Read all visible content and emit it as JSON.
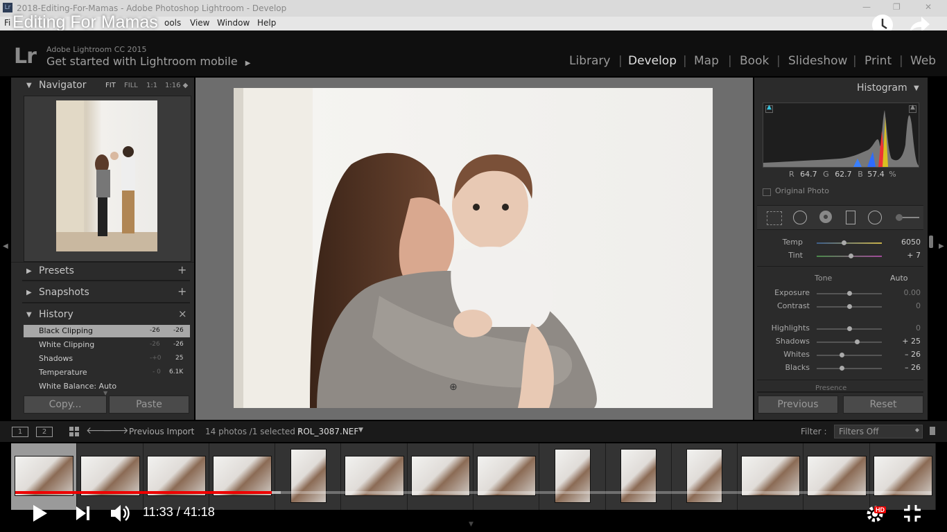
{
  "window": {
    "title": "2018-Editing-For-Mamas - Adobe Photoshop Lightroom - Develop",
    "app_icon": "Lr",
    "controls": [
      "—",
      "❐",
      "✕"
    ]
  },
  "menu": {
    "items": [
      "Fi",
      "ools",
      "View",
      "Window",
      "Help"
    ]
  },
  "video": {
    "title": "Editing For Mamas",
    "time": "11:33 / 41:18",
    "progress": 0.28,
    "quality_badge": "HD",
    "colors": {
      "played": "#e00000"
    }
  },
  "lr_header": {
    "logo": "Lr",
    "version": "Adobe Lightroom CC 2015",
    "mobile": "Get started with Lightroom mobile",
    "mobile_arrow": "▶",
    "modules": [
      "Library",
      "Develop",
      "Map",
      "Book",
      "Slideshow",
      "Print",
      "Web"
    ],
    "active_module": "Develop"
  },
  "left_panel": {
    "navigator": {
      "title": "Navigator",
      "zoom_options": [
        "FIT",
        "FILL",
        "1:1",
        "1:16 ◆"
      ]
    },
    "presets": {
      "title": "Presets",
      "action": "+"
    },
    "snapshots": {
      "title": "Snapshots",
      "action": "+"
    },
    "history": {
      "title": "History",
      "action": "×",
      "rows": [
        {
          "label": "Black Clipping",
          "a": "-26",
          "b": "-26",
          "selected": true
        },
        {
          "label": "White Clipping",
          "a": "-26",
          "b": "-26",
          "selected": false
        },
        {
          "label": "Shadows",
          "a": "-+0",
          "b": "25",
          "selected": false
        },
        {
          "label": "Temperature",
          "a": "- 0",
          "b": "6.1K",
          "selected": false
        },
        {
          "label": "White Balance: Auto",
          "a": "",
          "b": "",
          "selected": false
        }
      ]
    },
    "copy_label": "Copy...",
    "paste_label": "Paste"
  },
  "right_panel": {
    "histogram": {
      "title": "Histogram",
      "readout": {
        "r_label": "R",
        "r": "64.7",
        "g_label": "G",
        "g": "62.7",
        "b_label": "B",
        "b": "57.4",
        "unit": "%"
      },
      "original_photo_label": "Original Photo"
    },
    "wb": [
      {
        "label": "Temp",
        "value": "6050",
        "pos": 0.42
      },
      {
        "label": "Tint",
        "value": "+ 7",
        "pos": 0.52
      }
    ],
    "tone": {
      "title": "Tone",
      "auto": "Auto",
      "sliders": [
        {
          "label": "Exposure",
          "value": "0.00",
          "pos": 0.5,
          "dim": true
        },
        {
          "label": "Contrast",
          "value": "0",
          "pos": 0.5,
          "dim": true
        },
        {
          "label": "Highlights",
          "value": "0",
          "pos": 0.5,
          "dim": true
        },
        {
          "label": "Shadows",
          "value": "+ 25",
          "pos": 0.62,
          "dim": false
        },
        {
          "label": "Whites",
          "value": "– 26",
          "pos": 0.38,
          "dim": false
        },
        {
          "label": "Blacks",
          "value": "– 26",
          "pos": 0.38,
          "dim": false
        }
      ],
      "next_section": "Presence"
    },
    "previous_label": "Previous",
    "reset_label": "Reset"
  },
  "filmstrip_bar": {
    "view1": "1",
    "view2": "2",
    "source": "Previous Import",
    "count": "14 photos /1 selected /",
    "filename": "ROL_3087.NEF",
    "filter_label": "Filter :",
    "filter_value": "Filters Off"
  },
  "filmstrip": {
    "thumbnail_count": 14,
    "selected_index": 0
  }
}
